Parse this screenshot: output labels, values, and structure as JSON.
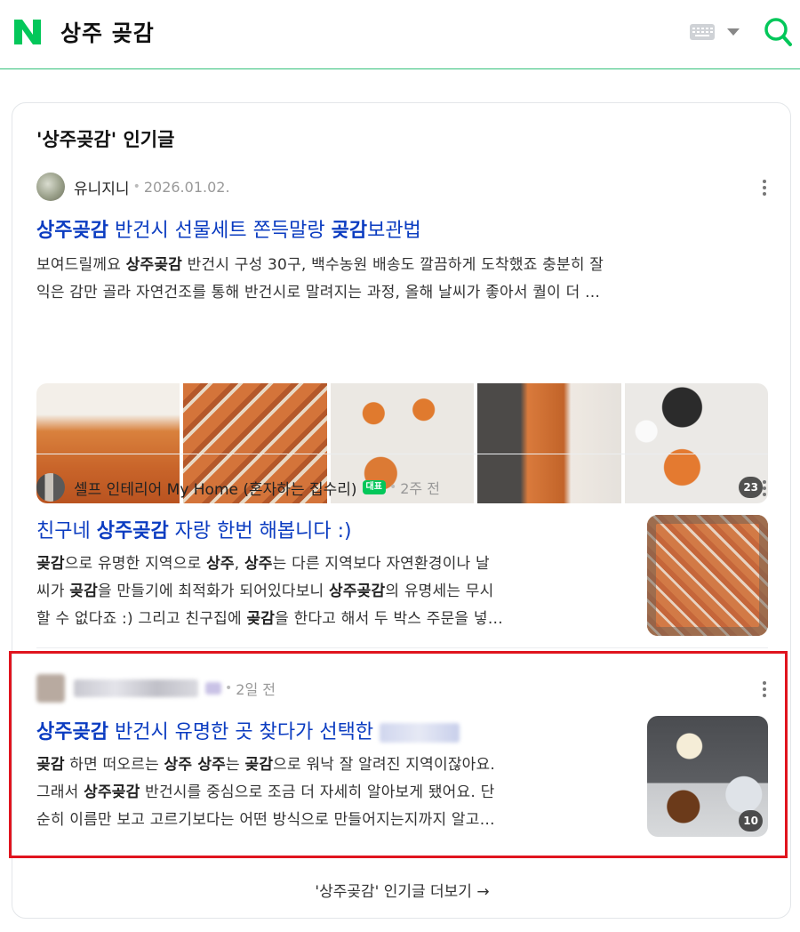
{
  "header": {
    "logo_letter": "N",
    "query": "상주 곶감",
    "colors": {
      "brand": "#03c75a",
      "search_icon": "#03c75a"
    }
  },
  "section": {
    "title": "'상주곶감' 인기글",
    "more_link": "'상주곶감' 인기글 더보기 →"
  },
  "posts": [
    {
      "author": "유니지니",
      "date": "2026.01.02.",
      "title_parts": [
        "상주곶감",
        " 반건시 선물세트 쫀득말랑 ",
        "곶감",
        "보관법"
      ],
      "desc_lines": [
        [
          "보여드릴께요 ",
          "상주곶감",
          " 반건시 구성 30구, 백수농원 배송도 깔끔하게 도착했죠 충분히 잘"
        ],
        [
          "익은 감만 골라 자연건조를 통해 반건시로 말려지는 과정, 올해 날씨가 좋아서 퀄이 더 …"
        ]
      ],
      "image_count": "23"
    },
    {
      "author": "셀프 인테리어 My Home (혼자하는 집수리)",
      "badge": "대표",
      "date": "2주 전",
      "title_parts": [
        "친구네 ",
        "상주곶감",
        " 자랑 한번 해봅니다 :)"
      ],
      "desc_lines": [
        [
          "곶감",
          "으로 유명한 지역으로 ",
          "상주",
          ", ",
          "상주",
          "는 다른 지역보다 자연환경이나 날"
        ],
        [
          "씨가 ",
          "곶감",
          "을 만들기에 최적화가 되어있다보니 ",
          "상주곶감",
          "의 유명세는 무시"
        ],
        [
          "할 수 없다죠 :) 그리고 친구집에 ",
          "곶감",
          "을 한다고 해서 두 박스 주문을 넣…"
        ]
      ]
    },
    {
      "date": "2일 전",
      "title_parts": [
        "상주곶감",
        " 반건시 유명한 곳 찾다가 선택한"
      ],
      "desc_lines": [
        [
          "곶감",
          " 하면 떠오르는 ",
          "상주 상주",
          "는 ",
          "곶감",
          "으로 워낙 잘 알려진 지역이잖아요."
        ],
        [
          "그래서 ",
          "상주곶감",
          " 반건시를 중심으로 조금 더 자세히 알아보게 됐어요. 단"
        ],
        [
          "순히 이름만 보고 고르기보다는 어떤 방식으로 만들어지는지까지 알고…"
        ]
      ],
      "image_count": "10"
    }
  ]
}
